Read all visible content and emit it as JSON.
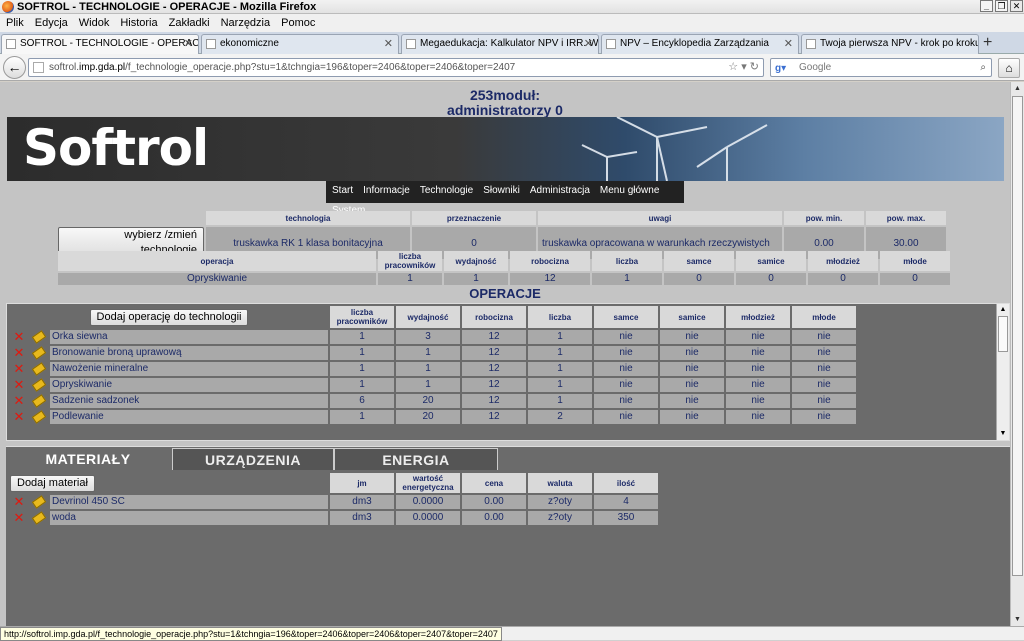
{
  "window": {
    "title": "SOFTROL - TECHNOLOGIE - OPERACJE - Mozilla Firefox"
  },
  "menu": [
    "Plik",
    "Edycja",
    "Widok",
    "Historia",
    "Zakładki",
    "Narzędzia",
    "Pomoc"
  ],
  "tabs": [
    {
      "label": "SOFTROL - TECHNOLOGIE - OPERACJE",
      "active": true
    },
    {
      "label": "ekonomiczne",
      "active": false
    },
    {
      "label": "Megaedukacja: Kalkulator NPV i IRR. Wy...",
      "active": false
    },
    {
      "label": "NPV – Encyklopedia Zarządzania",
      "active": false
    },
    {
      "label": "Twoja pierwsza NPV - krok po kroku",
      "active": false
    }
  ],
  "url": {
    "host": "softrol.",
    "domain": "imp.gda.pl",
    "path": "/f_technologie_operacje.php?stu=1&tchngia=196&toper=2406&toper=2406&toper=2407"
  },
  "search": {
    "placeholder": "Google"
  },
  "page": {
    "module_line1": "253moduł:",
    "module_line2": "administratorzy 0",
    "logo": "Softrol",
    "nav": [
      "Start",
      "Informacje",
      "Technologie",
      "Słowniki",
      "Administracja",
      "Menu główne",
      "System"
    ]
  },
  "tech_table": {
    "button": "wybierz /zmień technologię",
    "headers": [
      "technologia",
      "przeznaczenie",
      "uwagi",
      "pow. min.",
      "pow. max."
    ],
    "row": [
      "truskawka RK 1 klasa bonitacyjna",
      "0",
      "truskawka opracowana w warunkach rzeczywistych",
      "0.00",
      "30.00"
    ]
  },
  "op_table": {
    "headers": [
      "operacja",
      "liczba pracowników",
      "wydajność",
      "robocizna",
      "liczba",
      "samce",
      "samice",
      "młodzież",
      "młode"
    ],
    "row": [
      "Opryskiwanie",
      "1",
      "1",
      "12",
      "1",
      "0",
      "0",
      "0",
      "0"
    ]
  },
  "operations": {
    "title": "OPERACJE",
    "add_button": "Dodaj operację do technologii",
    "headers": [
      "liczba pracowników",
      "wydajność",
      "robocizna",
      "liczba",
      "samce",
      "samice",
      "młodzież",
      "młode"
    ],
    "rows": [
      [
        "Orka siewna",
        "1",
        "3",
        "12",
        "1",
        "nie",
        "nie",
        "nie",
        "nie"
      ],
      [
        "Bronowanie broną uprawową",
        "1",
        "1",
        "12",
        "1",
        "nie",
        "nie",
        "nie",
        "nie"
      ],
      [
        "Nawożenie mineralne",
        "1",
        "1",
        "12",
        "1",
        "nie",
        "nie",
        "nie",
        "nie"
      ],
      [
        "Opryskiwanie",
        "1",
        "1",
        "12",
        "1",
        "nie",
        "nie",
        "nie",
        "nie"
      ],
      [
        "Sadzenie sadzonek",
        "6",
        "20",
        "12",
        "1",
        "nie",
        "nie",
        "nie",
        "nie"
      ],
      [
        "Podlewanie",
        "1",
        "20",
        "12",
        "2",
        "nie",
        "nie",
        "nie",
        "nie"
      ]
    ]
  },
  "lower_tabs": [
    "MATERIAŁY",
    "URZĄDZENIA",
    "ENERGIA"
  ],
  "materials": {
    "add_button": "Dodaj materiał",
    "headers": [
      "jm",
      "wartość energetyczna",
      "cena",
      "waluta",
      "ilość"
    ],
    "rows": [
      [
        "Devrinol 450 SC",
        "dm3",
        "0.0000",
        "0.00",
        "z?oty",
        "4"
      ],
      [
        "woda",
        "dm3",
        "0.0000",
        "0.00",
        "z?oty",
        "350"
      ]
    ]
  },
  "status": {
    "url": "http://softrol.imp.gda.pl/f_technologie_operacje.php?stu=1&tchngia=196&toper=2406&toper=2406&toper=2407&toper=2407"
  }
}
